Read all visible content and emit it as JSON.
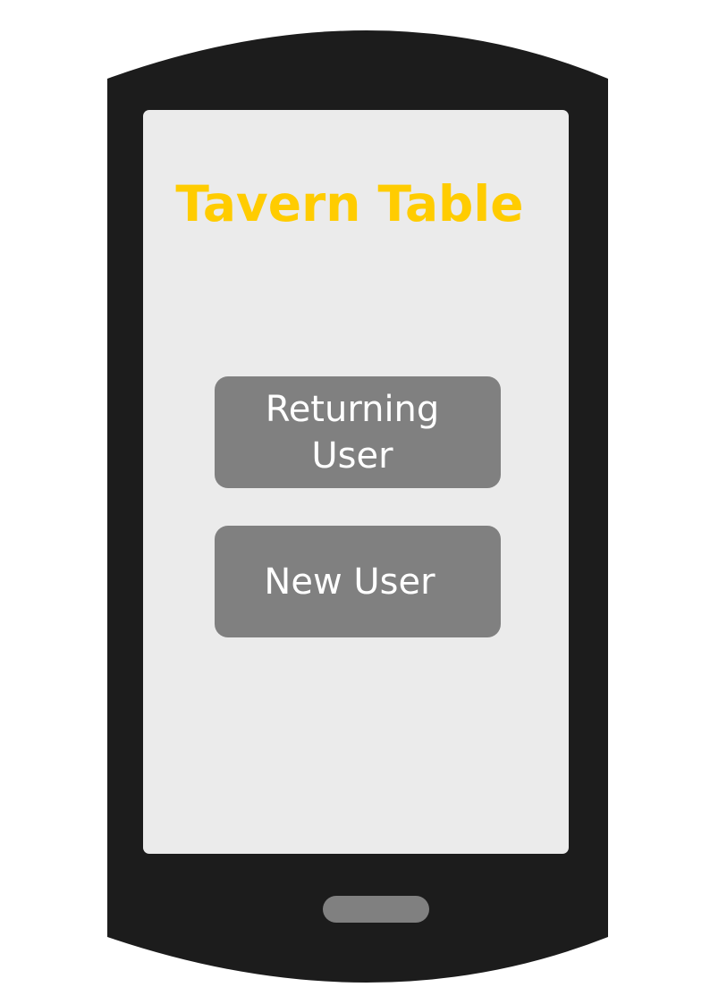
{
  "app": {
    "title": "Tavern Table"
  },
  "buttons": {
    "returning_user": {
      "line1": "Returning",
      "line2": "User"
    },
    "new_user": {
      "label": "New User"
    }
  },
  "colors": {
    "phone_body": "#1c1c1c",
    "screen_background": "#ebebeb",
    "title": "#ffcc00",
    "button_background": "#808080",
    "button_text": "#ffffff",
    "home_button": "#808080"
  },
  "icons": {
    "home_button": "home-button-pill"
  }
}
